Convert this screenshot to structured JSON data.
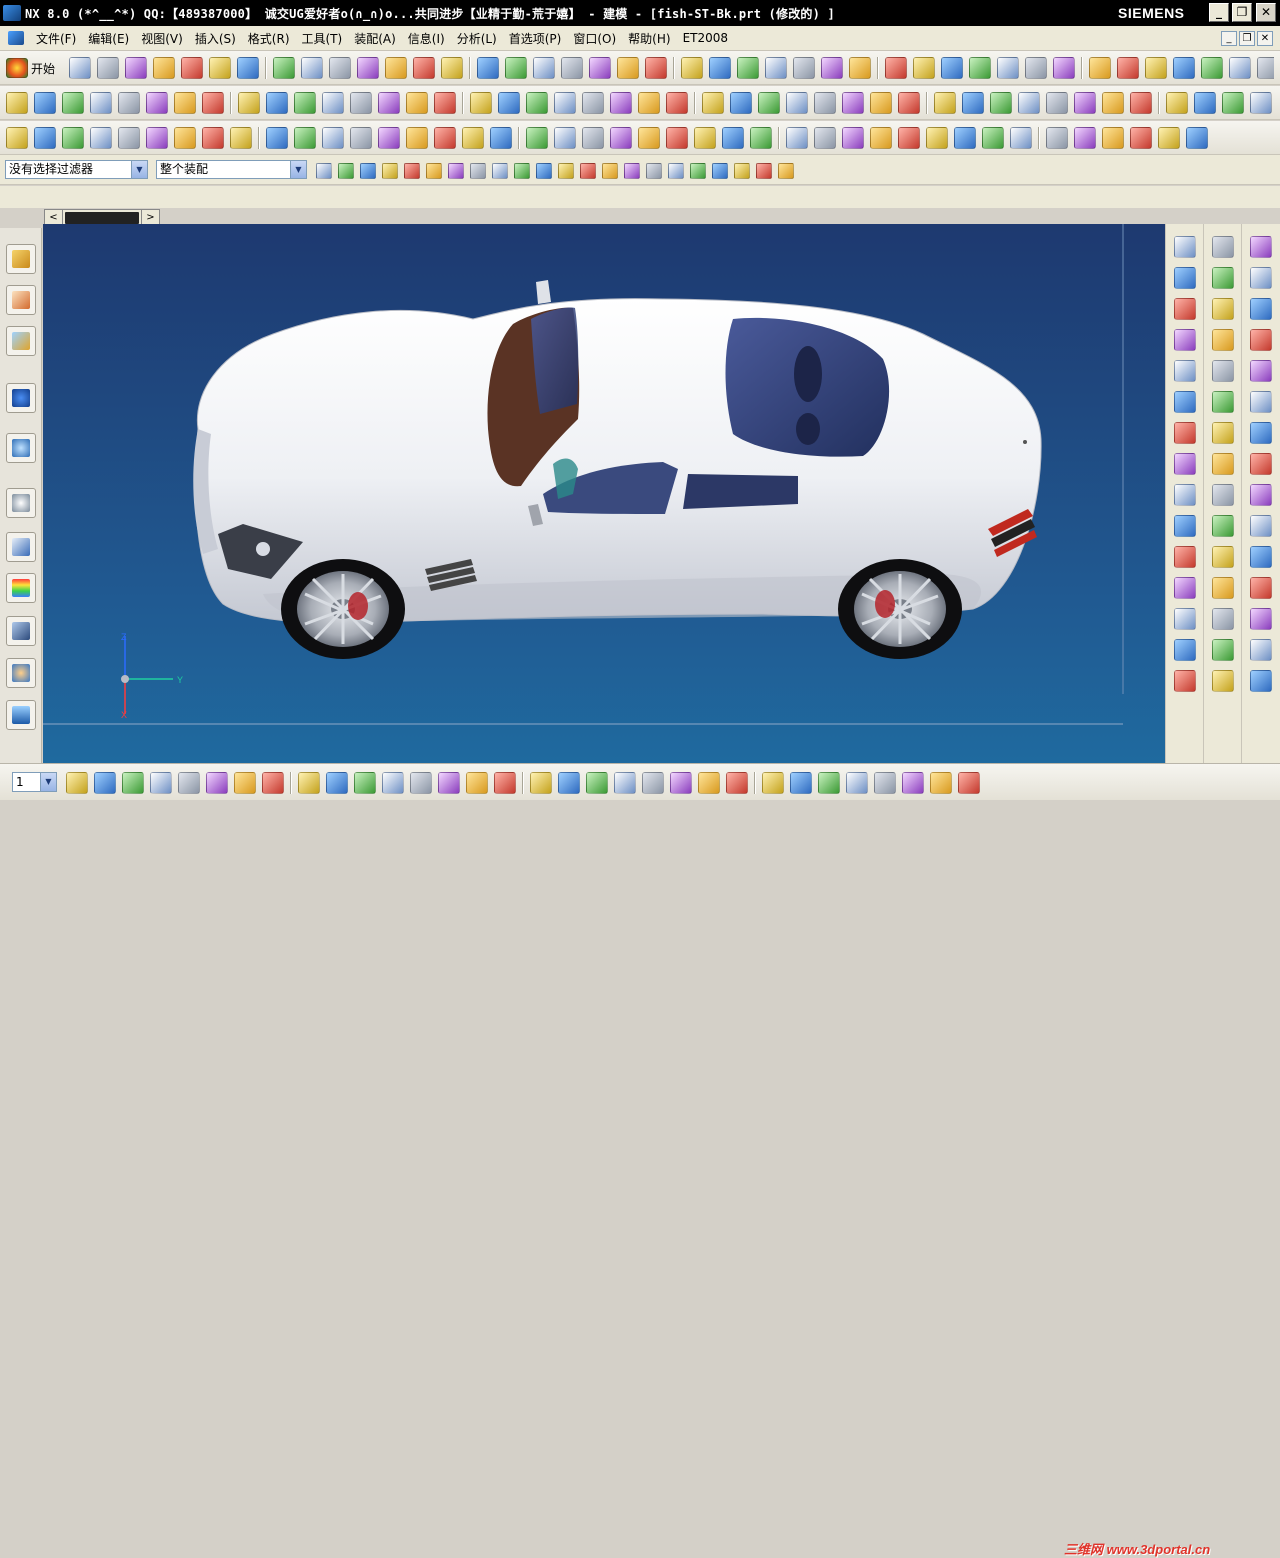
{
  "titlebar": {
    "title": "NX 8.0 (*^__^*) QQ:【489387000】 诚交UG爱好者o(∩_∩)o...共同进步【业精于勤-荒于嬉】 - 建模 - [fish-ST-Bk.prt  (修改的) ]",
    "brand": "SIEMENS",
    "minimize": "_",
    "restore": "❐",
    "close": "✕"
  },
  "menubar": {
    "items": [
      "文件(F)",
      "编辑(E)",
      "视图(V)",
      "插入(S)",
      "格式(R)",
      "工具(T)",
      "装配(A)",
      "信息(I)",
      "分析(L)",
      "首选项(P)",
      "窗口(O)",
      "帮助(H)",
      "ET2008"
    ],
    "mdi_minimize": "_",
    "mdi_restore": "❐",
    "mdi_close": "✕"
  },
  "toolbar1": {
    "start_label": "开始"
  },
  "filterbar": {
    "selection_filter": "没有选择过滤器",
    "selection_scope": "整个装配"
  },
  "tabstrip": {
    "left": "<",
    "right": ">"
  },
  "viewport": {
    "axis": {
      "z_label": "Z",
      "y_label": "Y",
      "x_label": "X"
    }
  },
  "bottombar": {
    "layer_value": "1"
  },
  "watermark": "三维网 www.3dportal.cn",
  "colors": {
    "viewport_top": "#1e3970",
    "viewport_bottom": "#1f6a9f",
    "car_body": "#f2f3f6",
    "glass": "#3d4f8e",
    "tire": "#111111",
    "rim": "#bfc3ca"
  }
}
